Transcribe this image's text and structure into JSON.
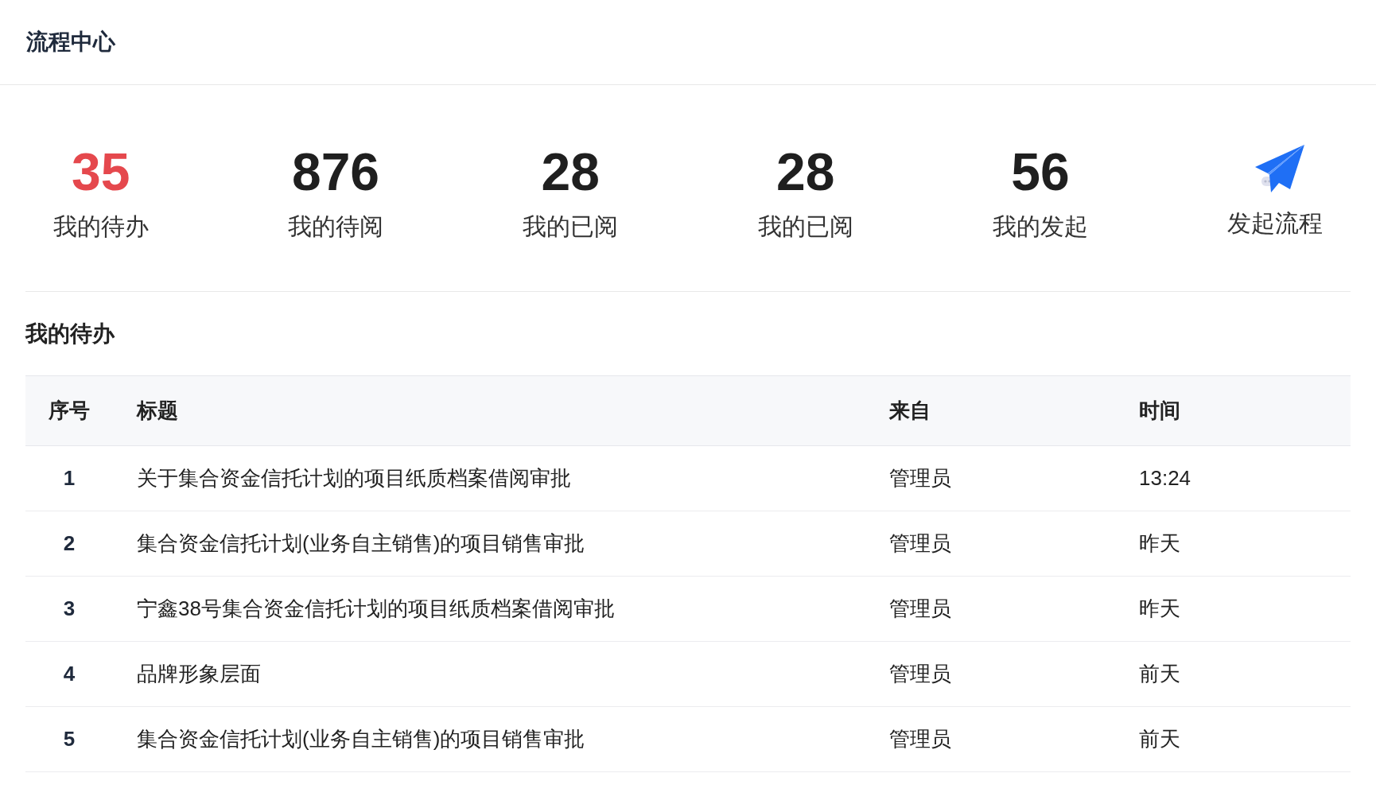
{
  "header": {
    "title": "流程中心"
  },
  "stats": [
    {
      "kind": "count",
      "value": "35",
      "label": "我的待办",
      "highlighted": true
    },
    {
      "kind": "count",
      "value": "876",
      "label": "我的待阅",
      "highlighted": false
    },
    {
      "kind": "count",
      "value": "28",
      "label": "我的已阅",
      "highlighted": false
    },
    {
      "kind": "count",
      "value": "28",
      "label": "我的已阅",
      "highlighted": false
    },
    {
      "kind": "count",
      "value": "56",
      "label": "我的发起",
      "highlighted": false
    },
    {
      "kind": "action",
      "label": "发起流程"
    }
  ],
  "section_title": "我的待办",
  "table": {
    "columns": [
      "序号",
      "标题",
      "来自",
      "时间"
    ],
    "rows": [
      [
        "1",
        "关于集合资金信托计划的项目纸质档案借阅审批",
        "管理员",
        "13:24"
      ],
      [
        "2",
        "集合资金信托计划(业务自主销售)的项目销售审批",
        "管理员",
        "昨天"
      ],
      [
        "3",
        "宁鑫38号集合资金信托计划的项目纸质档案借阅审批",
        "管理员",
        "昨天"
      ],
      [
        "4",
        "品牌形象层面",
        "管理员",
        "前天"
      ],
      [
        "5",
        "集合资金信托计划(业务自主销售)的项目销售审批",
        "管理员",
        "前天"
      ]
    ]
  }
}
